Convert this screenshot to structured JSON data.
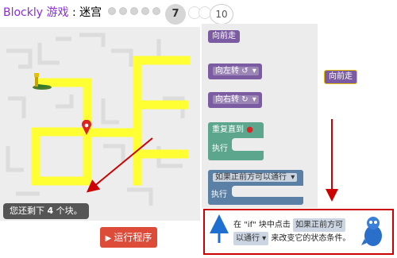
{
  "header": {
    "app_name": "Blockly 游戏",
    "separator": " : ",
    "game_name": "迷宫",
    "current_level": "7",
    "last_level": "10"
  },
  "maze": {
    "blocks_left_prefix": "您还剩下",
    "blocks_left_count": "4",
    "blocks_left_suffix": "个块。"
  },
  "run_button": {
    "label": "运行程序"
  },
  "toolbox": {
    "move_forward": "向前走",
    "turn_left": "向左转",
    "turn_right": "向右转",
    "turn_symbol": "↺",
    "turn_symbol_right": "↻",
    "repeat_until": "重复直到",
    "do": "执行",
    "if_path": "如果正前方可以通行",
    "if_do": "执行"
  },
  "workspace": {
    "block_label": "向前走"
  },
  "hint": {
    "line1_a": "在",
    "line1_b": "\"if\"",
    "line1_c": "块中点击",
    "chip1": "如果正前方可",
    "chip2": "以通行",
    "line2_rest": "来改变它的状态条件。"
  },
  "colors": {
    "accent_purple": "#7b5ba1",
    "loop_green": "#5ca68d",
    "logic_blue": "#5b80a5",
    "run_red": "#dd4b39",
    "path_yellow": "#ffff33",
    "annotation_red": "#cc0000"
  }
}
